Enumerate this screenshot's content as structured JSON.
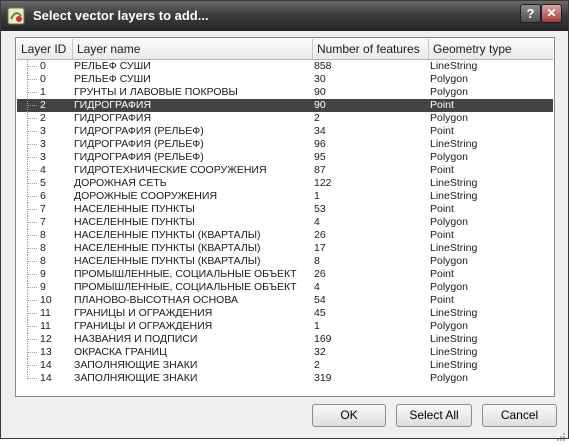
{
  "window": {
    "title": "Select vector layers to add..."
  },
  "titlebar": {
    "help_label": "?",
    "close_label": "✕"
  },
  "table": {
    "headers": [
      "Layer ID",
      "Layer name",
      "Number of features",
      "Geometry type"
    ],
    "selected_index": 3,
    "rows": [
      {
        "id": "0",
        "name": "РЕЛЬЕФ СУШИ",
        "count": "858",
        "geom": "LineString"
      },
      {
        "id": "0",
        "name": "РЕЛЬЕФ СУШИ",
        "count": "30",
        "geom": "Polygon"
      },
      {
        "id": "1",
        "name": "ГРУНТЫ И ЛАВОВЫЕ ПОКРОВЫ",
        "count": "90",
        "geom": "Polygon"
      },
      {
        "id": "2",
        "name": "ГИДРОГРАФИЯ",
        "count": "90",
        "geom": "Point"
      },
      {
        "id": "2",
        "name": "ГИДРОГРАФИЯ",
        "count": "2",
        "geom": "Polygon"
      },
      {
        "id": "3",
        "name": "ГИДРОГРАФИЯ (РЕЛЬЕФ)",
        "count": "34",
        "geom": "Point"
      },
      {
        "id": "3",
        "name": "ГИДРОГРАФИЯ (РЕЛЬЕФ)",
        "count": "96",
        "geom": "LineString"
      },
      {
        "id": "3",
        "name": "ГИДРОГРАФИЯ (РЕЛЬЕФ)",
        "count": "95",
        "geom": "Polygon"
      },
      {
        "id": "4",
        "name": "ГИДРОТЕХНИЧЕСКИЕ СООРУЖЕНИЯ",
        "count": "87",
        "geom": "Point"
      },
      {
        "id": "5",
        "name": "ДОРОЖНАЯ СЕТЬ",
        "count": "122",
        "geom": "LineString"
      },
      {
        "id": "6",
        "name": "ДОРОЖНЫЕ СООРУЖЕНИЯ",
        "count": "1",
        "geom": "LineString"
      },
      {
        "id": "7",
        "name": "НАСЕЛЕННЫЕ ПУНКТЫ",
        "count": "53",
        "geom": "Point"
      },
      {
        "id": "7",
        "name": "НАСЕЛЕННЫЕ ПУНКТЫ",
        "count": "4",
        "geom": "Polygon"
      },
      {
        "id": "8",
        "name": "НАСЕЛЕННЫЕ ПУНКТЫ (КВАРТАЛЫ)",
        "count": "26",
        "geom": "Point"
      },
      {
        "id": "8",
        "name": "НАСЕЛЕННЫЕ ПУНКТЫ (КВАРТАЛЫ)",
        "count": "17",
        "geom": "LineString"
      },
      {
        "id": "8",
        "name": "НАСЕЛЕННЫЕ ПУНКТЫ (КВАРТАЛЫ)",
        "count": "8",
        "geom": "Polygon"
      },
      {
        "id": "9",
        "name": "ПРОМЫШЛЕННЫЕ, СОЦИАЛЬНЫЕ ОБЪЕКТ",
        "count": "26",
        "geom": "Point"
      },
      {
        "id": "9",
        "name": "ПРОМЫШЛЕННЫЕ, СОЦИАЛЬНЫЕ ОБЪЕКТ",
        "count": "4",
        "geom": "Polygon"
      },
      {
        "id": "10",
        "name": "ПЛАНОВО-ВЫСОТНАЯ ОСНОВА",
        "count": "54",
        "geom": "Point"
      },
      {
        "id": "11",
        "name": "ГРАНИЦЫ И ОГРАЖДЕНИЯ",
        "count": "45",
        "geom": "LineString"
      },
      {
        "id": "11",
        "name": "ГРАНИЦЫ И ОГРАЖДЕНИЯ",
        "count": "1",
        "geom": "Polygon"
      },
      {
        "id": "12",
        "name": "НАЗВАНИЯ И ПОДПИСИ",
        "count": "169",
        "geom": "LineString"
      },
      {
        "id": "13",
        "name": "ОКРАСКА ГРАНИЦ",
        "count": "32",
        "geom": "LineString"
      },
      {
        "id": "14",
        "name": "ЗАПОЛНЯЮЩИЕ ЗНАКИ",
        "count": "2",
        "geom": "LineString"
      },
      {
        "id": "14",
        "name": "ЗАПОЛНЯЮЩИЕ ЗНАКИ",
        "count": "319",
        "geom": "Polygon"
      }
    ]
  },
  "buttons": {
    "ok": "OK",
    "select_all": "Select All",
    "cancel": "Cancel"
  },
  "icons": {
    "app": "qgis-app-icon",
    "help": "help-icon",
    "close": "close-icon",
    "grip": "resize-grip-icon"
  },
  "colors": {
    "selection": "#434343",
    "title_bar": "#3d3d3d",
    "close_button": "#a23a3a"
  }
}
